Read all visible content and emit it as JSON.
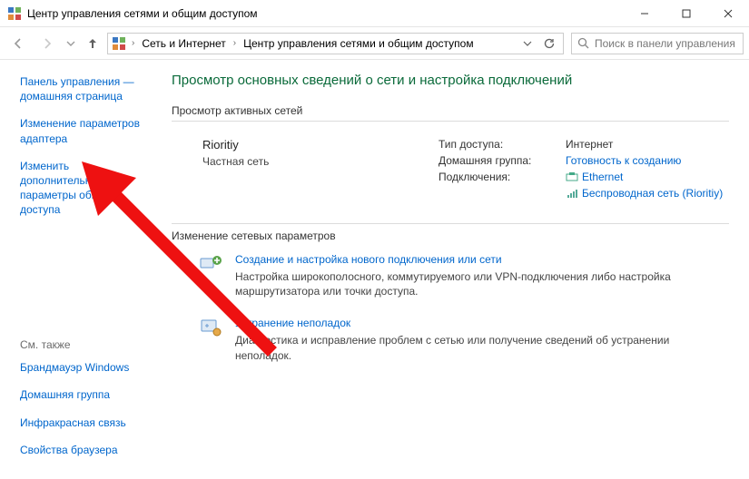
{
  "window": {
    "title": "Центр управления сетями и общим доступом"
  },
  "breadcrumb": {
    "seg1": "Сеть и Интернет",
    "seg2": "Центр управления сетями и общим доступом"
  },
  "search": {
    "placeholder": "Поиск в панели управления"
  },
  "sidebar": {
    "home": "Панель управления — домашняя страница",
    "adapter": "Изменение параметров адаптера",
    "sharing": "Изменить дополнительные параметры общего доступа",
    "see_also_label": "См. также",
    "see_also": [
      "Брандмауэр Windows",
      "Домашняя группа",
      "Инфракрасная связь",
      "Свойства браузера"
    ]
  },
  "main": {
    "title": "Просмотр основных сведений о сети и настройка подключений",
    "active_label": "Просмотр активных сетей",
    "network": {
      "name": "Rioritiy",
      "type": "Частная сеть",
      "access_key": "Тип доступа:",
      "access_val": "Интернет",
      "homegroup_key": "Домашняя группа:",
      "homegroup_val": "Готовность к созданию",
      "conn_key": "Подключения:",
      "conn_eth": "Ethernet",
      "conn_wifi": "Беспроводная сеть (Rioritiy)"
    },
    "settings_label": "Изменение сетевых параметров",
    "actions": [
      {
        "title": "Создание и настройка нового подключения или сети",
        "desc": "Настройка широкополосного, коммутируемого или VPN-подключения либо настройка маршрутизатора или точки доступа."
      },
      {
        "title": "Устранение неполадок",
        "desc": "Диагностика и исправление проблем с сетью или получение сведений об устранении неполадок."
      }
    ]
  }
}
